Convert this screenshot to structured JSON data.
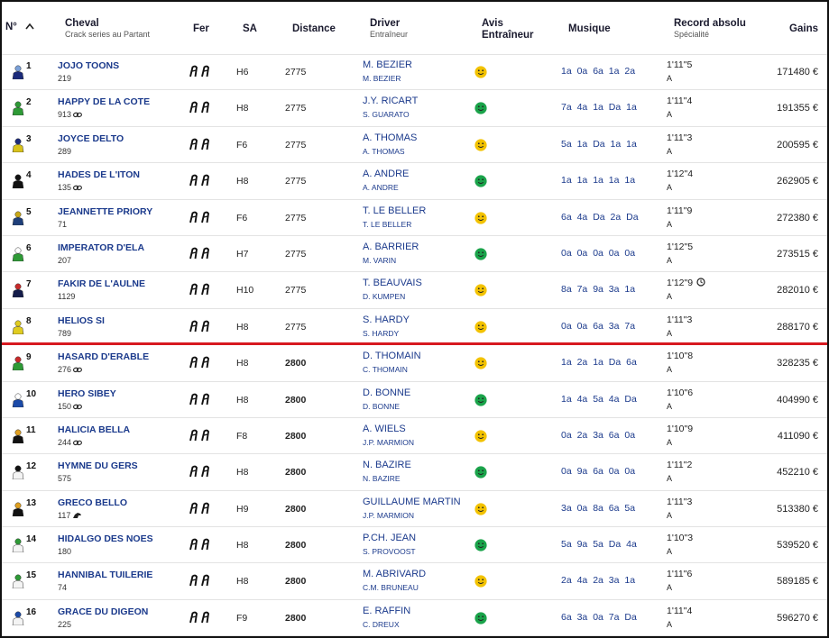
{
  "header": {
    "num_label": "N°",
    "cheval_label": "Cheval",
    "cheval_sub": "Crack series au Partant",
    "fer_label": "Fer",
    "sa_label": "SA",
    "distance_label": "Distance",
    "driver_label": "Driver",
    "driver_sub": "Entraîneur",
    "avis_label": "Avis",
    "avis_label2": "Entraîneur",
    "musique_label": "Musique",
    "record_label": "Record absolu",
    "record_sub": "Spécialité",
    "gains_label": "Gains"
  },
  "colors": {
    "link": "#1b3a8c",
    "separator": "#d71920",
    "smile_yellow": "#f2c200",
    "smile_green": "#1aa34a"
  },
  "rows": [
    {
      "num": "1",
      "name": "JOJO TOONS",
      "sub": "219",
      "sub_icon": "",
      "sa": "H6",
      "distance": "2775",
      "driver": "M. BEZIER",
      "trainer": "M. BEZIER",
      "avis": "yellow",
      "musique": "1a 0a 6a 1a 2a",
      "record": "1'11\"5",
      "record_icon": "",
      "spec": "A",
      "gains": "171480 €",
      "jockey_color": "#1b2a7a",
      "jockey_cap": "#7aa0d8"
    },
    {
      "num": "2",
      "name": "HAPPY DE LA COTE",
      "sub": "913",
      "sub_icon": "link",
      "sa": "H8",
      "distance": "2775",
      "driver": "J.Y. RICART",
      "trainer": "S. GUARATO",
      "avis": "green",
      "musique": "7a 4a 1a Da 1a",
      "record": "1'11\"4",
      "record_icon": "",
      "spec": "A",
      "gains": "191355 €",
      "jockey_color": "#2e9a36",
      "jockey_cap": "#2e9a36"
    },
    {
      "num": "3",
      "name": "JOYCE DELTO",
      "sub": "289",
      "sub_icon": "",
      "sa": "F6",
      "distance": "2775",
      "driver": "A. THOMAS",
      "trainer": "A. THOMAS",
      "avis": "yellow",
      "musique": "5a 1a Da 1a 1a",
      "record": "1'11\"3",
      "record_icon": "",
      "spec": "A",
      "gains": "200595 €",
      "jockey_color": "#d8c21a",
      "jockey_cap": "#1b2a7a"
    },
    {
      "num": "4",
      "name": "HADES DE L'ITON",
      "sub": "135",
      "sub_icon": "link",
      "sa": "H8",
      "distance": "2775",
      "driver": "A. ANDRE",
      "trainer": "A. ANDRE",
      "avis": "green",
      "musique": "1a 1a 1a 1a 1a",
      "record": "1'12\"4",
      "record_icon": "",
      "spec": "A",
      "gains": "262905 €",
      "jockey_color": "#111111",
      "jockey_cap": "#111111"
    },
    {
      "num": "5",
      "name": "JEANNETTE PRIORY",
      "sub": "71",
      "sub_icon": "",
      "sa": "F6",
      "distance": "2775",
      "driver": "T. LE BELLER",
      "trainer": "T. LE BELLER",
      "avis": "yellow",
      "musique": "6a 4a Da 2a Da",
      "record": "1'11\"9",
      "record_icon": "",
      "spec": "A",
      "gains": "272380 €",
      "jockey_color": "#1e3f7a",
      "jockey_cap": "#c8a818"
    },
    {
      "num": "6",
      "name": "IMPERATOR D'ELA",
      "sub": "207",
      "sub_icon": "",
      "sa": "H7",
      "distance": "2775",
      "driver": "A. BARRIER",
      "trainer": "M. VARIN",
      "avis": "green",
      "musique": "0a 0a 0a 0a 0a",
      "record": "1'12\"5",
      "record_icon": "",
      "spec": "A",
      "gains": "273515 €",
      "jockey_color": "#2e9a36",
      "jockey_cap": "#ffffff"
    },
    {
      "num": "7",
      "name": "FAKIR DE L'AULNE",
      "sub": "1129",
      "sub_icon": "",
      "sa": "H10",
      "distance": "2775",
      "driver": "T. BEAUVAIS",
      "trainer": "D. KUMPEN",
      "avis": "yellow",
      "musique": "8a 7a 9a 3a 1a",
      "record": "1'12\"9",
      "record_icon": "clock",
      "spec": "A",
      "gains": "282010 €",
      "jockey_color": "#141c4a",
      "jockey_cap": "#c82a2a"
    },
    {
      "num": "8",
      "name": "HELIOS SI",
      "sub": "789",
      "sub_icon": "",
      "sa": "H8",
      "distance": "2775",
      "driver": "S. HARDY",
      "trainer": "S. HARDY",
      "avis": "yellow",
      "musique": "0a 0a 6a 3a 7a",
      "record": "1'11\"3",
      "record_icon": "",
      "spec": "A",
      "gains": "288170 €",
      "jockey_color": "#e0cc20",
      "jockey_cap": "#e0cc20"
    },
    {
      "num": "9",
      "name": "HASARD D'ERABLE",
      "sub": "276",
      "sub_icon": "link",
      "sa": "H8",
      "distance": "2800",
      "driver": "D. THOMAIN",
      "trainer": "C. THOMAIN",
      "avis": "yellow",
      "musique": "1a 2a 1a Da 6a",
      "record": "1'10\"8",
      "record_icon": "",
      "spec": "A",
      "gains": "328235 €",
      "jockey_color": "#2e9a36",
      "jockey_cap": "#c82a2a"
    },
    {
      "num": "10",
      "name": "HERO SIBEY",
      "sub": "150",
      "sub_icon": "link",
      "sa": "H8",
      "distance": "2800",
      "driver": "D. BONNE",
      "trainer": "D. BONNE",
      "avis": "green",
      "musique": "1a 4a 5a 4a Da",
      "record": "1'10\"6",
      "record_icon": "",
      "spec": "A",
      "gains": "404990 €",
      "jockey_color": "#1b4aa8",
      "jockey_cap": "#ffffff"
    },
    {
      "num": "11",
      "name": "HALICIA BELLA",
      "sub": "244",
      "sub_icon": "link",
      "sa": "F8",
      "distance": "2800",
      "driver": "A. WIELS",
      "trainer": "J.P. MARMION",
      "avis": "yellow",
      "musique": "0a 2a 3a 6a 0a",
      "record": "1'10\"9",
      "record_icon": "",
      "spec": "A",
      "gains": "411090 €",
      "jockey_color": "#111111",
      "jockey_cap": "#e0a020"
    },
    {
      "num": "12",
      "name": "HYMNE DU GERS",
      "sub": "575",
      "sub_icon": "",
      "sa": "H8",
      "distance": "2800",
      "driver": "N. BAZIRE",
      "trainer": "N. BAZIRE",
      "avis": "green",
      "musique": "0a 9a 6a 0a 0a",
      "record": "1'11\"2",
      "record_icon": "",
      "spec": "A",
      "gains": "452210 €",
      "jockey_color": "#f4f4f4",
      "jockey_cap": "#111111"
    },
    {
      "num": "13",
      "name": "GRECO BELLO",
      "sub": "117",
      "sub_icon": "horse",
      "sa": "H9",
      "distance": "2800",
      "driver": "GUILLAUME MARTIN",
      "trainer": "J.P. MARMION",
      "avis": "yellow",
      "musique": "3a 0a 8a 6a 5a",
      "record": "1'11\"3",
      "record_icon": "",
      "spec": "A",
      "gains": "513380 €",
      "jockey_color": "#111111",
      "jockey_cap": "#e0a020"
    },
    {
      "num": "14",
      "name": "HIDALGO DES NOES",
      "sub": "180",
      "sub_icon": "",
      "sa": "H8",
      "distance": "2800",
      "driver": "P.CH. JEAN",
      "trainer": "S. PROVOOST",
      "avis": "green",
      "musique": "5a 9a 5a Da 4a",
      "record": "1'10\"3",
      "record_icon": "",
      "spec": "A",
      "gains": "539520 €",
      "jockey_color": "#f4f4f4",
      "jockey_cap": "#2e9a36"
    },
    {
      "num": "15",
      "name": "HANNIBAL TUILERIE",
      "sub": "74",
      "sub_icon": "",
      "sa": "H8",
      "distance": "2800",
      "driver": "M. ABRIVARD",
      "trainer": "C.M. BRUNEAU",
      "avis": "yellow",
      "musique": "2a 4a 2a 3a 1a",
      "record": "1'11\"6",
      "record_icon": "",
      "spec": "A",
      "gains": "589185 €",
      "jockey_color": "#f4f4f4",
      "jockey_cap": "#2e9a36"
    },
    {
      "num": "16",
      "name": "GRACE DU DIGEON",
      "sub": "225",
      "sub_icon": "",
      "sa": "F9",
      "distance": "2800",
      "driver": "E. RAFFIN",
      "trainer": "C. DREUX",
      "avis": "green",
      "musique": "6a 3a 0a 7a Da",
      "record": "1'11\"4",
      "record_icon": "",
      "spec": "A",
      "gains": "596270 €",
      "jockey_color": "#f4f4f4",
      "jockey_cap": "#1b4aa8"
    }
  ]
}
